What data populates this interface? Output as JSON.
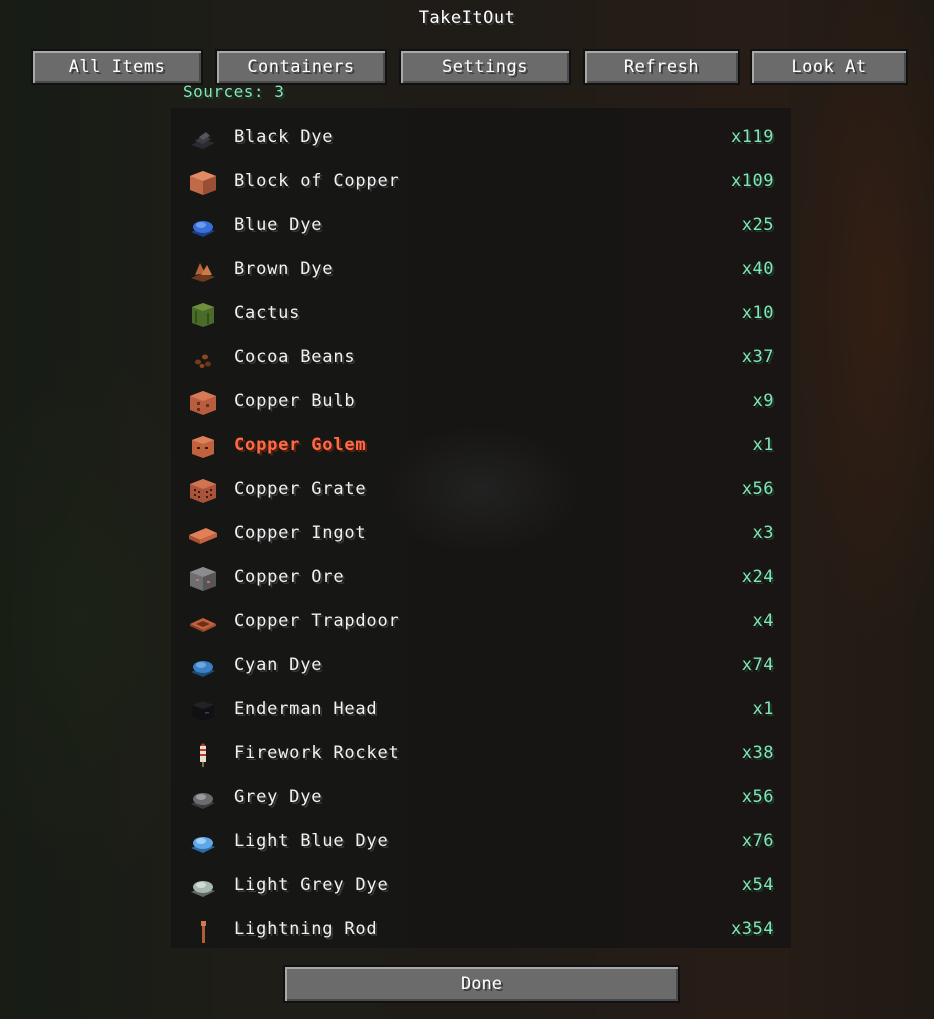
{
  "title": "TakeItOut",
  "tabs": [
    {
      "label": "All Items"
    },
    {
      "label": "Containers"
    },
    {
      "label": "Settings"
    },
    {
      "label": "Refresh"
    },
    {
      "label": "Look At"
    }
  ],
  "sources_text": "Sources: 3",
  "items": [
    {
      "name": "Black Dye",
      "count": "x119",
      "icon": "black-dye-icon"
    },
    {
      "name": "Block of Copper",
      "count": "x109",
      "icon": "copper-block-icon"
    },
    {
      "name": "Blue Dye",
      "count": "x25",
      "icon": "blue-dye-icon"
    },
    {
      "name": "Brown Dye",
      "count": "x40",
      "icon": "brown-dye-icon"
    },
    {
      "name": "Cactus",
      "count": "x10",
      "icon": "cactus-icon"
    },
    {
      "name": "Cocoa Beans",
      "count": "x37",
      "icon": "cocoa-beans-icon"
    },
    {
      "name": "Copper Bulb",
      "count": "x9",
      "icon": "copper-bulb-icon"
    },
    {
      "name": "Copper Golem",
      "count": "x1",
      "icon": "copper-golem-icon",
      "highlight": true
    },
    {
      "name": "Copper Grate",
      "count": "x56",
      "icon": "copper-grate-icon"
    },
    {
      "name": "Copper Ingot",
      "count": "x3",
      "icon": "copper-ingot-icon"
    },
    {
      "name": "Copper Ore",
      "count": "x24",
      "icon": "copper-ore-icon"
    },
    {
      "name": "Copper Trapdoor",
      "count": "x4",
      "icon": "copper-trapdoor-icon"
    },
    {
      "name": "Cyan Dye",
      "count": "x74",
      "icon": "cyan-dye-icon"
    },
    {
      "name": "Enderman Head",
      "count": "x1",
      "icon": "enderman-head-icon"
    },
    {
      "name": "Firework Rocket",
      "count": "x38",
      "icon": "firework-rocket-icon"
    },
    {
      "name": "Grey Dye",
      "count": "x56",
      "icon": "grey-dye-icon"
    },
    {
      "name": "Light Blue Dye",
      "count": "x76",
      "icon": "light-blue-dye-icon"
    },
    {
      "name": "Light Grey Dye",
      "count": "x54",
      "icon": "light-grey-dye-icon"
    },
    {
      "name": "Lightning Rod",
      "count": "x354",
      "icon": "lightning-rod-icon"
    }
  ],
  "done_label": "Done",
  "colors": {
    "count_text": "#7fe8b4",
    "highlight_text": "#ff6a45",
    "button_face": "#6b6b6b"
  }
}
